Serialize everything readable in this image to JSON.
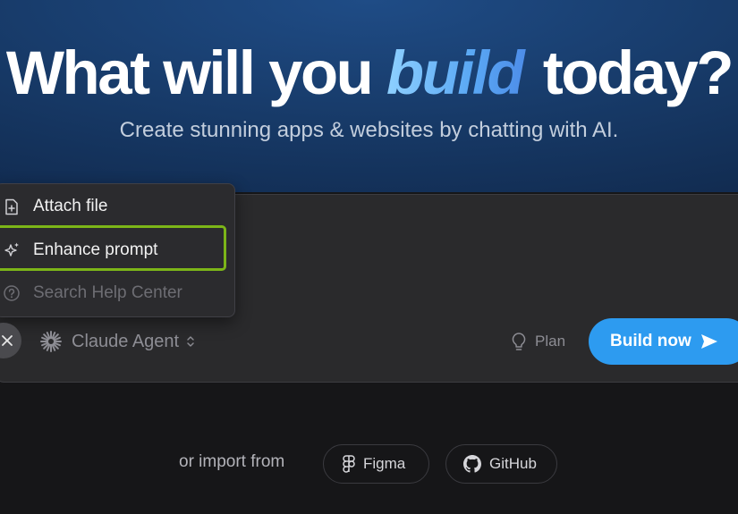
{
  "hero": {
    "headline_before": "What will you ",
    "headline_accent": "build",
    "headline_after": " today?",
    "subtitle": "Create stunning apps & websites by chatting with AI."
  },
  "menu": {
    "items": [
      {
        "label": "Attach file",
        "icon": "attach-file-icon",
        "disabled": false
      },
      {
        "label": "Enhance prompt",
        "icon": "sparkle-icon",
        "disabled": false,
        "highlighted": true
      },
      {
        "label": "Search Help Center",
        "icon": "help-circle-icon",
        "disabled": true
      }
    ]
  },
  "toolbar": {
    "close_icon": "close-icon",
    "model_label": "Claude Agent",
    "plan_label": "Plan",
    "build_label": "Build now"
  },
  "import": {
    "label": "or import from",
    "figma_label": "Figma",
    "github_label": "GitHub"
  },
  "colors": {
    "accent_blue": "#2d9bf0",
    "highlight_green": "#7cb518",
    "background": "#161618",
    "panel": "#2a2a2c"
  }
}
